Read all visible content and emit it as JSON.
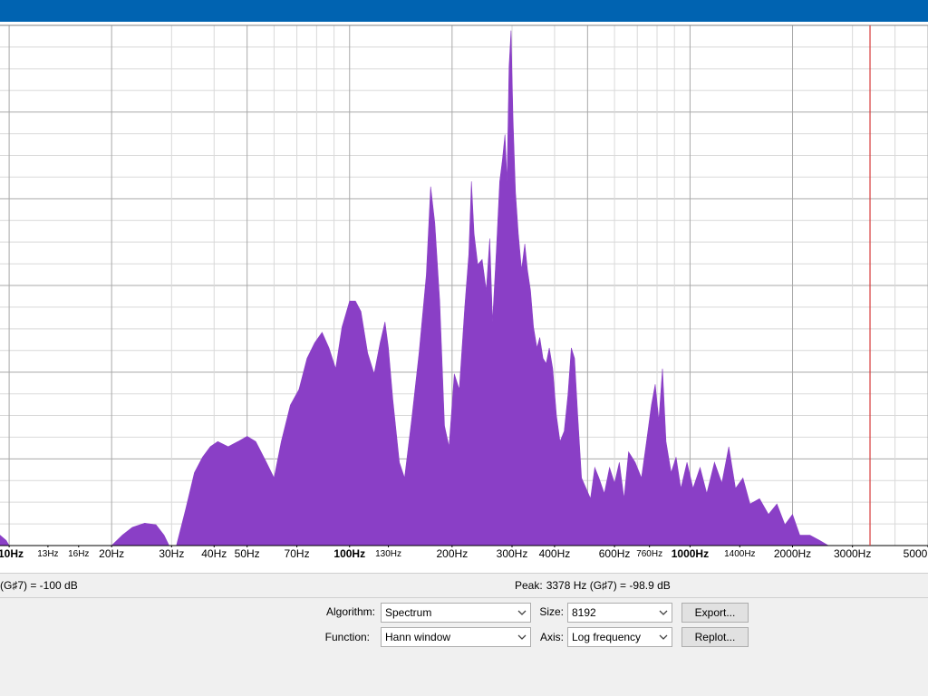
{
  "colors": {
    "titlebar": "#0063b1",
    "spectrum_fill": "#8a3fc6",
    "grid_major": "#a9a9a9",
    "grid_minor": "#d9d9d9",
    "cursor_line": "#d63a3a"
  },
  "chart_data": {
    "type": "area",
    "title": "",
    "xlabel": "",
    "ylabel": "",
    "x_scale": "log",
    "xlim": [
      9.4,
      5000
    ],
    "ylim_fraction": [
      0,
      1
    ],
    "grid": true,
    "tick_labels": [
      {
        "text": "10Hz",
        "freq": 10,
        "style": "bold"
      },
      {
        "text": "13Hz",
        "freq": 13,
        "style": "small"
      },
      {
        "text": "16Hz",
        "freq": 16,
        "style": "small"
      },
      {
        "text": "20Hz",
        "freq": 20,
        "style": "normal"
      },
      {
        "text": "30Hz",
        "freq": 30,
        "style": "normal"
      },
      {
        "text": "40Hz",
        "freq": 40,
        "style": "normal"
      },
      {
        "text": "50Hz",
        "freq": 50,
        "style": "normal"
      },
      {
        "text": "70Hz",
        "freq": 70,
        "style": "normal"
      },
      {
        "text": "100Hz",
        "freq": 100,
        "style": "bold"
      },
      {
        "text": "130Hz",
        "freq": 130,
        "style": "small"
      },
      {
        "text": "200Hz",
        "freq": 200,
        "style": "normal"
      },
      {
        "text": "300Hz",
        "freq": 300,
        "style": "normal"
      },
      {
        "text": "400Hz",
        "freq": 400,
        "style": "normal"
      },
      {
        "text": "600Hz",
        "freq": 600,
        "style": "normal"
      },
      {
        "text": "760Hz",
        "freq": 760,
        "style": "small"
      },
      {
        "text": "1000Hz",
        "freq": 1000,
        "style": "bold"
      },
      {
        "text": "1400Hz",
        "freq": 1400,
        "style": "small"
      },
      {
        "text": "2000Hz",
        "freq": 2000,
        "style": "normal"
      },
      {
        "text": "3000Hz",
        "freq": 3000,
        "style": "normal"
      },
      {
        "text": "5000",
        "freq": 5000,
        "style": "normal"
      }
    ],
    "cursor_freq": 3378,
    "spectrum": [
      [
        9.4,
        0.02
      ],
      [
        9.8,
        0.01
      ],
      [
        10,
        0.0
      ],
      [
        20,
        0.0
      ],
      [
        21.5,
        0.02
      ],
      [
        23,
        0.035
      ],
      [
        25,
        0.043
      ],
      [
        27,
        0.04
      ],
      [
        28.5,
        0.02
      ],
      [
        29.5,
        0.0
      ],
      [
        31,
        0.0
      ],
      [
        33,
        0.07
      ],
      [
        35,
        0.14
      ],
      [
        37,
        0.17
      ],
      [
        39,
        0.19
      ],
      [
        41,
        0.2
      ],
      [
        44,
        0.19
      ],
      [
        47,
        0.2
      ],
      [
        50,
        0.21
      ],
      [
        53,
        0.2
      ],
      [
        57,
        0.16
      ],
      [
        60,
        0.13
      ],
      [
        63,
        0.2
      ],
      [
        67,
        0.27
      ],
      [
        71,
        0.3
      ],
      [
        75,
        0.36
      ],
      [
        79,
        0.39
      ],
      [
        83,
        0.41
      ],
      [
        87,
        0.38
      ],
      [
        91,
        0.34
      ],
      [
        95,
        0.42
      ],
      [
        100,
        0.47
      ],
      [
        104,
        0.47
      ],
      [
        108,
        0.45
      ],
      [
        113,
        0.37
      ],
      [
        118,
        0.33
      ],
      [
        123,
        0.39
      ],
      [
        127,
        0.43
      ],
      [
        130,
        0.38
      ],
      [
        134,
        0.28
      ],
      [
        140,
        0.16
      ],
      [
        145,
        0.13
      ],
      [
        152,
        0.24
      ],
      [
        160,
        0.37
      ],
      [
        168,
        0.52
      ],
      [
        173,
        0.69
      ],
      [
        178,
        0.62
      ],
      [
        184,
        0.47
      ],
      [
        190,
        0.23
      ],
      [
        196,
        0.19
      ],
      [
        203,
        0.33
      ],
      [
        210,
        0.3
      ],
      [
        218,
        0.46
      ],
      [
        224,
        0.56
      ],
      [
        228,
        0.7
      ],
      [
        232,
        0.6
      ],
      [
        238,
        0.54
      ],
      [
        245,
        0.55
      ],
      [
        252,
        0.49
      ],
      [
        258,
        0.59
      ],
      [
        263,
        0.43
      ],
      [
        270,
        0.57
      ],
      [
        276,
        0.7
      ],
      [
        281,
        0.74
      ],
      [
        286,
        0.79
      ],
      [
        290,
        0.7
      ],
      [
        294,
        0.92
      ],
      [
        298,
        0.99
      ],
      [
        302,
        0.82
      ],
      [
        307,
        0.68
      ],
      [
        313,
        0.6
      ],
      [
        320,
        0.53
      ],
      [
        327,
        0.58
      ],
      [
        333,
        0.53
      ],
      [
        340,
        0.49
      ],
      [
        347,
        0.42
      ],
      [
        355,
        0.38
      ],
      [
        362,
        0.4
      ],
      [
        370,
        0.36
      ],
      [
        378,
        0.35
      ],
      [
        386,
        0.38
      ],
      [
        395,
        0.34
      ],
      [
        405,
        0.25
      ],
      [
        415,
        0.2
      ],
      [
        427,
        0.22
      ],
      [
        438,
        0.29
      ],
      [
        448,
        0.38
      ],
      [
        458,
        0.36
      ],
      [
        468,
        0.25
      ],
      [
        480,
        0.13
      ],
      [
        495,
        0.11
      ],
      [
        510,
        0.09
      ],
      [
        525,
        0.15
      ],
      [
        540,
        0.13
      ],
      [
        560,
        0.1
      ],
      [
        580,
        0.15
      ],
      [
        600,
        0.12
      ],
      [
        620,
        0.16
      ],
      [
        640,
        0.09
      ],
      [
        660,
        0.18
      ],
      [
        690,
        0.16
      ],
      [
        720,
        0.13
      ],
      [
        745,
        0.2
      ],
      [
        770,
        0.27
      ],
      [
        790,
        0.31
      ],
      [
        810,
        0.24
      ],
      [
        830,
        0.34
      ],
      [
        850,
        0.2
      ],
      [
        880,
        0.14
      ],
      [
        910,
        0.17
      ],
      [
        940,
        0.11
      ],
      [
        980,
        0.16
      ],
      [
        1020,
        0.11
      ],
      [
        1070,
        0.15
      ],
      [
        1120,
        0.1
      ],
      [
        1180,
        0.16
      ],
      [
        1240,
        0.12
      ],
      [
        1300,
        0.19
      ],
      [
        1360,
        0.11
      ],
      [
        1430,
        0.13
      ],
      [
        1500,
        0.08
      ],
      [
        1600,
        0.09
      ],
      [
        1700,
        0.06
      ],
      [
        1800,
        0.08
      ],
      [
        1900,
        0.04
      ],
      [
        2000,
        0.06
      ],
      [
        2100,
        0.02
      ],
      [
        2250,
        0.02
      ],
      [
        2400,
        0.01
      ],
      [
        2550,
        0.0
      ],
      [
        5000,
        0.0
      ]
    ]
  },
  "readouts": {
    "cursor": "(G♯7) = -100 dB",
    "peak_label": "Peak:",
    "peak_value": "3378 Hz (G♯7) = -98.9 dB"
  },
  "controls": {
    "algorithm_label": "Algorithm:",
    "algorithm_value": "Spectrum",
    "function_label": "Function:",
    "function_value": "Hann window",
    "size_label": "Size:",
    "size_value": "8192",
    "axis_label": "Axis:",
    "axis_value": "Log frequency",
    "export_label": "Export...",
    "replot_label": "Replot..."
  }
}
